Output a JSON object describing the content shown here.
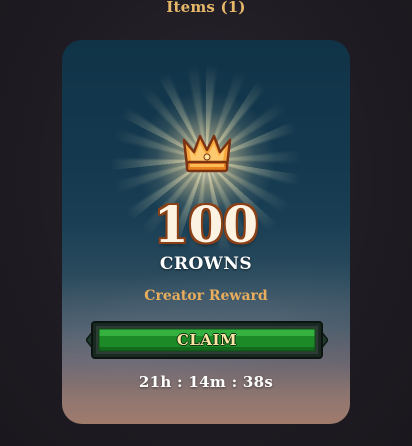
{
  "header": {
    "title": "Items (1)"
  },
  "reward": {
    "icon": "crown-icon",
    "amount": "100",
    "unit": "CROWNS",
    "subtitle": "Creator Reward",
    "claim_label": "CLAIM",
    "countdown": "21h : 14m : 38s"
  },
  "colors": {
    "header_text": "#e7b86a",
    "subtitle_text": "#e8ad5d",
    "button_green": "#1f9a2a",
    "button_frame": "#1b2a24",
    "crown_gold": "#f3a63c"
  }
}
